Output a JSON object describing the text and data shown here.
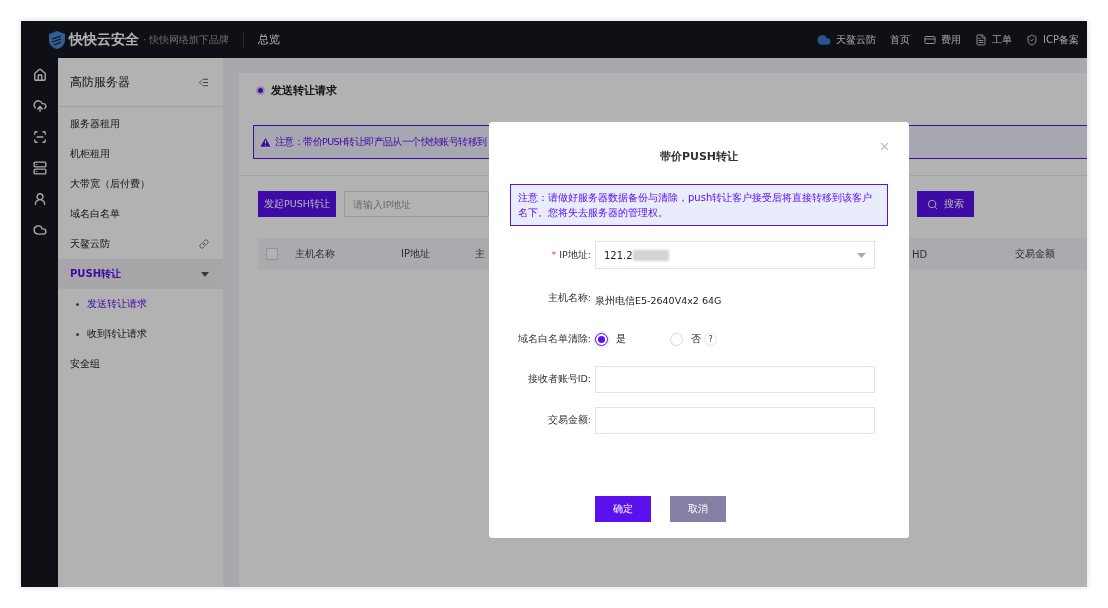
{
  "topbar": {
    "brand": "快快云安全",
    "tagline": "· 快快网络旗下品牌",
    "section": "总览",
    "links": [
      {
        "label": "天鳌云防",
        "kind": "cloud"
      },
      {
        "label": "首页",
        "kind": "plain"
      },
      {
        "label": "费用",
        "kind": "card"
      },
      {
        "label": "工单",
        "kind": "doc"
      },
      {
        "label": "ICP备案",
        "kind": "shield"
      }
    ]
  },
  "sidebar": {
    "title": "高防服务器",
    "items": [
      {
        "label": "服务器租用",
        "kind": "item",
        "selected": false
      },
      {
        "label": "机柜租用",
        "kind": "item",
        "selected": false
      },
      {
        "label": "大带宽（后付费）",
        "kind": "item",
        "selected": false
      },
      {
        "label": "域名白名单",
        "kind": "item",
        "selected": false
      },
      {
        "label": "天鳌云防",
        "kind": "external",
        "selected": false
      },
      {
        "label": "PUSH转让",
        "kind": "group",
        "selected": true,
        "expanded": true,
        "children": [
          {
            "label": "发送转让请求",
            "selected": true
          },
          {
            "label": "收到转让请求",
            "selected": false
          }
        ]
      },
      {
        "label": "安全组",
        "kind": "item",
        "selected": false
      }
    ]
  },
  "page": {
    "title": "发送转让请求",
    "alert": "注意：带价PUSH转让即产品从一个快快账号转移到",
    "action_button": "发起PUSH转让",
    "search": {
      "placeholder": "请输入IP地址"
    },
    "search_button": "搜索",
    "table": {
      "select_all_checked": false,
      "columns": [
        "主机名称",
        "IP地址",
        "主",
        "HD",
        "交易金额"
      ]
    }
  },
  "modal": {
    "title": "带价PUSH转让",
    "required_symbol": "*",
    "notice": "注意：请做好服务器数据备份与清除，push转让客户接受后将直接转移到该客户名下。您将失去服务器的管理权。",
    "fields": [
      {
        "kind": "select",
        "label": "IP地址:",
        "required": true,
        "value": "121.2"
      },
      {
        "kind": "text",
        "label": "主机名称:",
        "required": false,
        "value": "泉州电信E5-2640V4x2 64G"
      },
      {
        "kind": "radio",
        "label": "域名白名单清除:",
        "required": false,
        "help": "?",
        "options": [
          {
            "label": "是",
            "selected": true
          },
          {
            "label": "否",
            "selected": false
          }
        ]
      },
      {
        "kind": "input",
        "label": "接收者账号ID:",
        "required": false
      },
      {
        "kind": "input",
        "label": "交易金额:",
        "required": false
      }
    ],
    "buttons": [
      {
        "label": "确定",
        "kind": "primary"
      },
      {
        "label": "取消",
        "kind": "secondary"
      }
    ]
  }
}
